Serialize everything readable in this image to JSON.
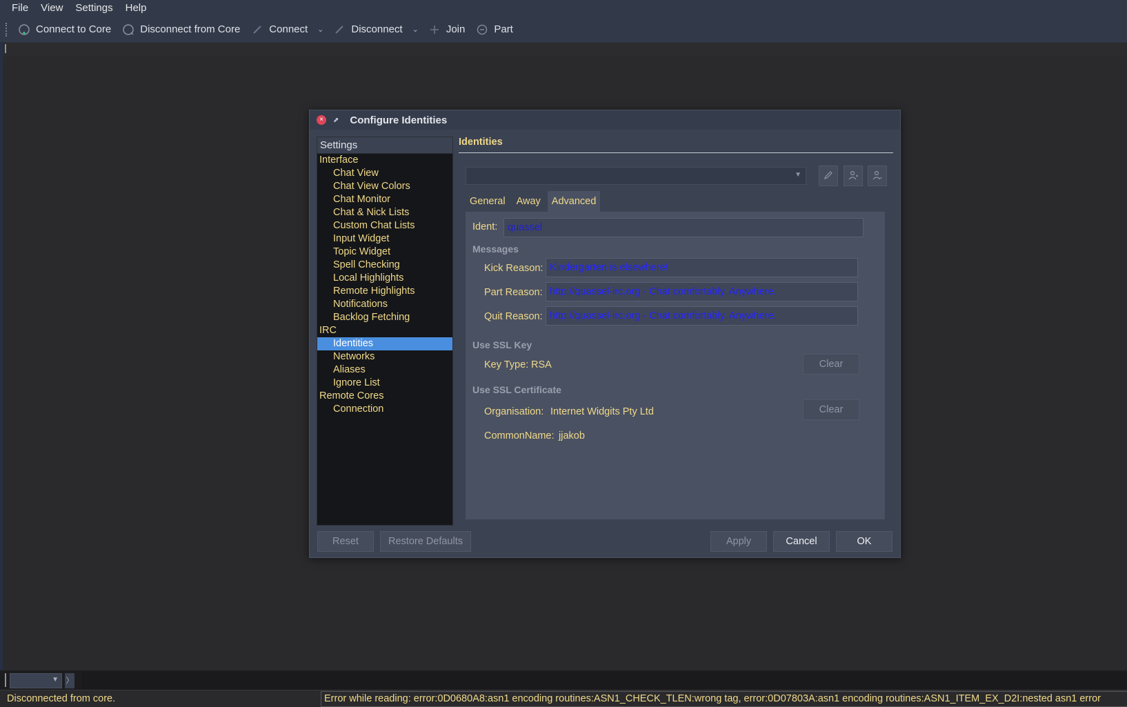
{
  "menubar": {
    "items": [
      {
        "label": "File"
      },
      {
        "label": "View"
      },
      {
        "label": "Settings"
      },
      {
        "label": "Help"
      }
    ]
  },
  "toolbar": {
    "connect_core": "Connect to Core",
    "disconnect_core": "Disconnect from Core",
    "connect": "Connect",
    "disconnect": "Disconnect",
    "join": "Join",
    "part": "Part"
  },
  "dialog": {
    "title": "Configure Identities",
    "tree": {
      "header": "Settings",
      "items": [
        {
          "label": "Interface",
          "level": 0
        },
        {
          "label": "Chat View",
          "level": 1
        },
        {
          "label": "Chat View Colors",
          "level": 1
        },
        {
          "label": "Chat Monitor",
          "level": 1
        },
        {
          "label": "Chat & Nick Lists",
          "level": 1
        },
        {
          "label": "Custom Chat Lists",
          "level": 1
        },
        {
          "label": "Input Widget",
          "level": 1
        },
        {
          "label": "Topic Widget",
          "level": 1
        },
        {
          "label": "Spell Checking",
          "level": 1
        },
        {
          "label": "Local Highlights",
          "level": 1
        },
        {
          "label": "Remote Highlights",
          "level": 1
        },
        {
          "label": "Notifications",
          "level": 1
        },
        {
          "label": "Backlog Fetching",
          "level": 1
        },
        {
          "label": "IRC",
          "level": 0
        },
        {
          "label": "Identities",
          "level": 1,
          "selected": true
        },
        {
          "label": "Networks",
          "level": 1
        },
        {
          "label": "Aliases",
          "level": 1
        },
        {
          "label": "Ignore List",
          "level": 1
        },
        {
          "label": "Remote Cores",
          "level": 0
        },
        {
          "label": "Connection",
          "level": 1
        }
      ]
    },
    "panel_title": "Identities",
    "identity_select": "",
    "tabs": [
      {
        "label": "General"
      },
      {
        "label": "Away"
      },
      {
        "label": "Advanced",
        "active": true
      }
    ],
    "advanced": {
      "ident_label": "Ident:",
      "ident_value": "quassel",
      "messages_header": "Messages",
      "kick_label": "Kick Reason:",
      "kick_value": "Kindergarten is elsewhere!",
      "part_label": "Part Reason:",
      "part_value": "http://quassel-irc.org - Chat comfortably. Anywhere.",
      "quit_label": "Quit Reason:",
      "quit_value": "http://quassel-irc.org - Chat comfortably. Anywhere.",
      "ssl_key_header": "Use SSL Key",
      "key_type_label": "Key Type:",
      "key_type_value": "RSA",
      "clear_key": "Clear",
      "ssl_cert_header": "Use SSL Certificate",
      "org_label": "Organisation:",
      "org_value": "Internet Widgits Pty Ltd",
      "clear_cert": "Clear",
      "cn_label": "CommonName:",
      "cn_value": "jjakob"
    },
    "buttons": {
      "reset": "Reset",
      "restore": "Restore Defaults",
      "apply": "Apply",
      "cancel": "Cancel",
      "ok": "OK"
    }
  },
  "statusbar": {
    "left": "Disconnected from core.",
    "error": "Error while reading: error:0D0680A8:asn1 encoding routines:ASN1_CHECK_TLEN:wrong tag, error:0D07803A:asn1 encoding routines:ASN1_ITEM_EX_D2I:nested asn1 error"
  },
  "colors": {
    "accent_selection": "#4a8fdf",
    "text_yellow": "#f0d98a",
    "field_text_blue": "#2323ff"
  }
}
